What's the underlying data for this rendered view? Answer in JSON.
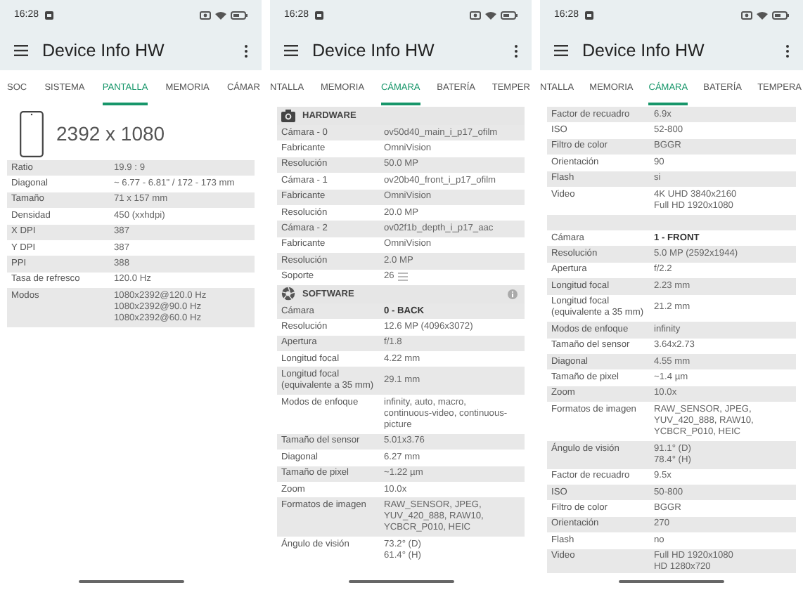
{
  "screens": [
    {
      "status_bar": {
        "time": "16:28"
      },
      "app_bar": {
        "title": "Device Info HW"
      },
      "tabs": [
        {
          "label": "SOC",
          "selected": false
        },
        {
          "label": "SISTEMA",
          "selected": false
        },
        {
          "label": "PANTALLA",
          "selected": true
        },
        {
          "label": "MEMORIA",
          "selected": false
        },
        {
          "label": "CÁMAR",
          "selected": false
        }
      ],
      "display_summary": "2392 x 1080",
      "sections": [
        {
          "rows": [
            {
              "kind": "info",
              "label": "Ratio",
              "value": "19.9 : 9"
            },
            {
              "kind": "info",
              "label": "Diagonal",
              "value": "~ 6.77 - 6.81\" / 172 - 173 mm"
            },
            {
              "kind": "info",
              "label": "Tamaño",
              "value": "71 x 157 mm"
            },
            {
              "kind": "info",
              "label": "Densidad",
              "value": "450 (xxhdpi)"
            },
            {
              "kind": "info",
              "label": "X DPI",
              "value": "387"
            },
            {
              "kind": "info",
              "label": "Y DPI",
              "value": "387"
            },
            {
              "kind": "info",
              "label": "PPI",
              "value": "388"
            },
            {
              "kind": "info",
              "label": "Tasa de refresco",
              "value": "120.0 Hz"
            },
            {
              "kind": "info",
              "label": "Modos",
              "value": "1080x2392@120.0 Hz\n1080x2392@90.0 Hz\n1080x2392@60.0 Hz"
            }
          ]
        }
      ]
    },
    {
      "status_bar": {
        "time": "16:28"
      },
      "app_bar": {
        "title": "Device Info HW"
      },
      "tabs": [
        {
          "label": "NTALLA",
          "selected": false
        },
        {
          "label": "MEMORIA",
          "selected": false
        },
        {
          "label": "CÁMARA",
          "selected": true
        },
        {
          "label": "BATERÍA",
          "selected": false
        },
        {
          "label": "TEMPER",
          "selected": false
        }
      ],
      "sections": [
        {
          "kind": "hardware",
          "title": "HARDWARE",
          "info": false,
          "rows": [
            {
              "kind": "info",
              "label": "Cámara - 0",
              "value": "ov50d40_main_i_p17_ofilm"
            },
            {
              "kind": "info",
              "label": "Fabricante",
              "value": "OmniVision"
            },
            {
              "kind": "info",
              "label": "Resolución",
              "value": "50.0 MP"
            },
            {
              "kind": "info",
              "label": "Cámara - 1",
              "value": "ov20b40_front_i_p17_ofilm"
            },
            {
              "kind": "info",
              "label": "Fabricante",
              "value": "OmniVision"
            },
            {
              "kind": "info",
              "label": "Resolución",
              "value": "20.0 MP"
            },
            {
              "kind": "info",
              "label": "Cámara - 2",
              "value": "ov02f1b_depth_i_p17_aac"
            },
            {
              "kind": "info",
              "label": "Fabricante",
              "value": "OmniVision"
            },
            {
              "kind": "info",
              "label": "Resolución",
              "value": "2.0 MP"
            },
            {
              "kind": "list",
              "label": "Soporte",
              "value": "26"
            }
          ]
        },
        {
          "kind": "software",
          "title": "SOFTWARE",
          "info": true,
          "rows": [
            {
              "kind": "camera",
              "label": "Cámara",
              "value": "0 - BACK"
            },
            {
              "kind": "info",
              "label": "Resolución",
              "value": "12.6 MP (4096x3072)"
            },
            {
              "kind": "info",
              "label": "Apertura",
              "value": "f/1.8"
            },
            {
              "kind": "info",
              "label": "Longitud focal",
              "value": "4.22 mm"
            },
            {
              "kind": "info",
              "label": "Longitud focal (equivalente a 35 mm)",
              "value": "29.1 mm"
            },
            {
              "kind": "info",
              "label": "Modos de enfoque",
              "value": "infinity, auto, macro, continuous-video, continuous-picture"
            },
            {
              "kind": "info",
              "label": "Tamaño del sensor",
              "value": "5.01x3.76"
            },
            {
              "kind": "info",
              "label": "Diagonal",
              "value": "6.27 mm"
            },
            {
              "kind": "info",
              "label": "Tamaño de pixel",
              "value": "~1.22 µm"
            },
            {
              "kind": "info",
              "label": "Zoom",
              "value": "10.0x"
            },
            {
              "kind": "info",
              "label": "Formatos de imagen",
              "value": "RAW_SENSOR, JPEG, YUV_420_888, RAW10, YCBCR_P010, HEIC"
            },
            {
              "kind": "info",
              "label": "Ángulo de visión",
              "value": "73.2° (D)\n61.4° (H)"
            }
          ]
        }
      ]
    },
    {
      "status_bar": {
        "time": "16:28"
      },
      "app_bar": {
        "title": "Device Info HW"
      },
      "tabs": [
        {
          "label": "NTALLA",
          "selected": false
        },
        {
          "label": "MEMORIA",
          "selected": false
        },
        {
          "label": "CÁMARA",
          "selected": true
        },
        {
          "label": "BATERÍA",
          "selected": false
        },
        {
          "label": "TEMPERA",
          "selected": false
        }
      ],
      "sections": [
        {
          "rows": [
            {
              "kind": "info",
              "label": "Factor de recuadro",
              "value": "6.9x"
            },
            {
              "kind": "info",
              "label": "ISO",
              "value": "52-800"
            },
            {
              "kind": "info",
              "label": "Filtro de color",
              "value": "BGGR"
            },
            {
              "kind": "info",
              "label": "Orientación",
              "value": "90"
            },
            {
              "kind": "info",
              "label": "Flash",
              "value": "si"
            },
            {
              "kind": "info",
              "label": "Video",
              "value": "4K UHD 3840x2160\nFull HD 1920x1080"
            },
            {
              "kind": "spacer"
            },
            {
              "kind": "camera",
              "label": "Cámara",
              "value": "1 - FRONT"
            },
            {
              "kind": "info",
              "label": "Resolución",
              "value": "5.0 MP (2592x1944)"
            },
            {
              "kind": "info",
              "label": "Apertura",
              "value": "f/2.2"
            },
            {
              "kind": "info",
              "label": "Longitud focal",
              "value": "2.23 mm"
            },
            {
              "kind": "info",
              "label": "Longitud focal (equivalente a 35 mm)",
              "value": "21.2 mm"
            },
            {
              "kind": "info",
              "label": "Modos de enfoque",
              "value": "infinity"
            },
            {
              "kind": "info",
              "label": "Tamaño del sensor",
              "value": "3.64x2.73"
            },
            {
              "kind": "info",
              "label": "Diagonal",
              "value": "4.55 mm"
            },
            {
              "kind": "info",
              "label": "Tamaño de pixel",
              "value": "~1.4 µm"
            },
            {
              "kind": "info",
              "label": "Zoom",
              "value": "10.0x"
            },
            {
              "kind": "info",
              "label": "Formatos de imagen",
              "value": "RAW_SENSOR, JPEG, YUV_420_888, RAW10, YCBCR_P010, HEIC"
            },
            {
              "kind": "info",
              "label": "Ángulo de visión",
              "value": "91.1° (D)\n78.4° (H)"
            },
            {
              "kind": "info",
              "label": "Factor de recuadro",
              "value": "9.5x"
            },
            {
              "kind": "info",
              "label": "ISO",
              "value": "50-800"
            },
            {
              "kind": "info",
              "label": "Filtro de color",
              "value": "BGGR"
            },
            {
              "kind": "info",
              "label": "Orientación",
              "value": "270"
            },
            {
              "kind": "info",
              "label": "Flash",
              "value": "no"
            },
            {
              "kind": "info",
              "label": "Video",
              "value": "Full HD 1920x1080\nHD 1280x720"
            }
          ]
        }
      ]
    }
  ]
}
